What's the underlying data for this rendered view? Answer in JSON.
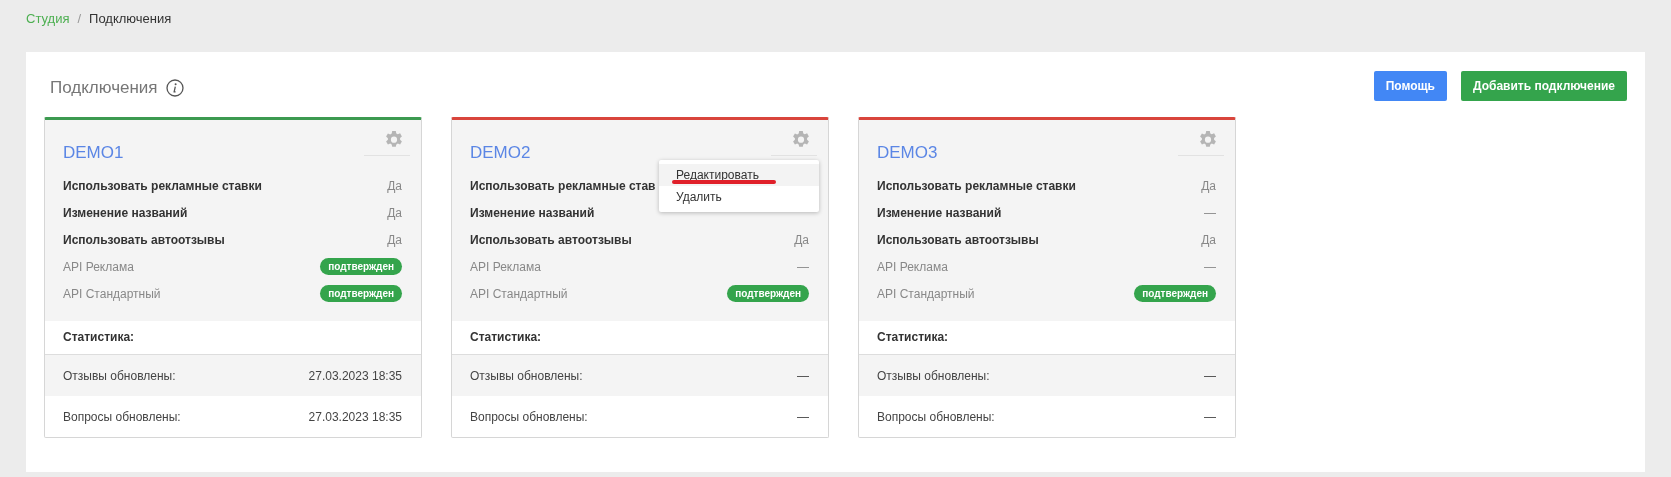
{
  "breadcrumb": [
    {
      "label": "Студия",
      "link": true
    },
    {
      "label": "Подключения",
      "link": false
    }
  ],
  "breadcrumb_separator": "/",
  "page": {
    "title": "Подключения",
    "buttons": [
      {
        "label": "Помощь",
        "kind": "info"
      },
      {
        "label": "Добавить подключение",
        "kind": "primary"
      }
    ]
  },
  "connections": [
    {
      "name": "DEMO1",
      "color": "#3c9a50",
      "settings": [
        {
          "kind": "setting",
          "label": "Использовать рекламные ставки",
          "value": "Да"
        },
        {
          "kind": "setting",
          "label": "Изменение названий",
          "value": "Да"
        },
        {
          "kind": "setting",
          "label": "Использовать автоотзывы",
          "value": "Да"
        },
        {
          "kind": "api",
          "label": "API Реклама",
          "badge": "подтвержден"
        },
        {
          "kind": "api",
          "label": "API Стандартный",
          "badge": "подтвержден"
        }
      ],
      "stats_title": "Статистика:",
      "stats": [
        {
          "label": "Отзывы обновлены:",
          "value": "27.03.2023 18:35"
        },
        {
          "label": "Вопросы обновлены:",
          "value": "27.03.2023 18:35"
        }
      ]
    },
    {
      "name": "DEMO2",
      "color": "#d9453c",
      "settings": [
        {
          "kind": "setting",
          "label": "Использовать рекламные став"
        },
        {
          "kind": "setting",
          "label": "Изменение названий"
        },
        {
          "kind": "setting",
          "label": "Использовать автоотзывы",
          "value": "Да"
        },
        {
          "kind": "api",
          "label": "API Реклама",
          "value": "—"
        },
        {
          "kind": "api",
          "label": "API Стандартный",
          "badge": "подтвержден"
        }
      ],
      "stats_title": "Статистика:",
      "stats": [
        {
          "label": "Отзывы обновлены:",
          "value": "—"
        },
        {
          "label": "Вопросы обновлены:",
          "value": "—"
        }
      ],
      "menu": [
        {
          "label": "Редактировать",
          "selected": true,
          "underlined": true
        },
        {
          "label": "Удалить",
          "selected": false,
          "underlined": false
        }
      ]
    },
    {
      "name": "DEMO3",
      "color": "#d9453c",
      "settings": [
        {
          "kind": "setting",
          "label": "Использовать рекламные ставки",
          "value": "Да"
        },
        {
          "kind": "setting",
          "label": "Изменение названий",
          "value": "—"
        },
        {
          "kind": "setting",
          "label": "Использовать автоотзывы",
          "value": "Да"
        },
        {
          "kind": "api",
          "label": "API Реклама",
          "value": "—"
        },
        {
          "kind": "api",
          "label": "API Стандартный",
          "badge": "подтвержден"
        }
      ],
      "stats_title": "Статистика:",
      "stats": [
        {
          "label": "Отзывы обновлены:",
          "value": "—"
        },
        {
          "label": "Вопросы обновлены:",
          "value": "—"
        }
      ]
    }
  ]
}
